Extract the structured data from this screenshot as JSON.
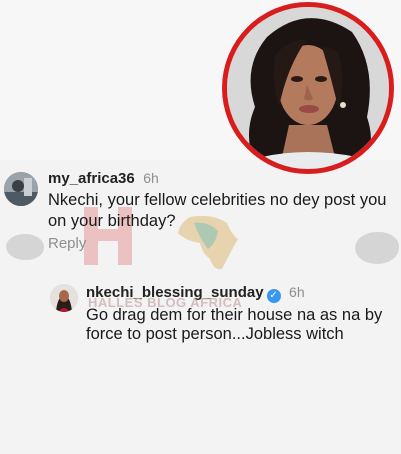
{
  "comments": [
    {
      "username": "my_africa36",
      "time": "6h",
      "text_line1": "Nkechi, your fellow celebrities no dey post you",
      "text_line2": "on your birthday?",
      "reply_label": "Reply"
    },
    {
      "username": "nkechi_blessing_sunday",
      "time": "6h",
      "verified": true,
      "text_line1": "Go drag dem for their house na as na by",
      "text_line2": "force to post person...Jobless witch"
    }
  ],
  "watermark": {
    "text": "HALLES BLOG AFRICA"
  },
  "colors": {
    "profile_ring": "#d91d1d",
    "verified": "#3897f0"
  },
  "icons": {
    "verified": "verified-badge-icon"
  }
}
